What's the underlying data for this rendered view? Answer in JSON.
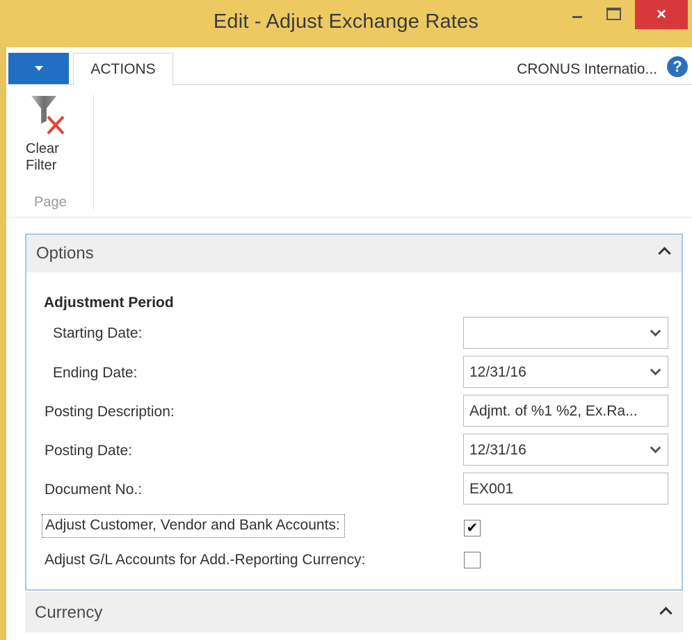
{
  "window": {
    "title": "Edit - Adjust Exchange Rates",
    "close_glyph": "×",
    "accent_color": "#edc962",
    "close_color": "#d9383a"
  },
  "ribbon": {
    "tab_actions": "ACTIONS",
    "company": "CRONUS Internatio...",
    "help_glyph": "?",
    "clear_filter_line1": "Clear",
    "clear_filter_line2": "Filter",
    "group_page": "Page"
  },
  "options": {
    "title": "Options",
    "group_caption": "Adjustment Period",
    "fields": {
      "starting_date": {
        "label": "Starting Date:",
        "value": ""
      },
      "ending_date": {
        "label": "Ending Date:",
        "value": "12/31/16"
      },
      "posting_description": {
        "label": "Posting Description:",
        "value": "Adjmt. of %1 %2, Ex.Ra..."
      },
      "posting_date": {
        "label": "Posting Date:",
        "value": "12/31/16"
      },
      "document_no": {
        "label": "Document No.:",
        "value": "EX001"
      },
      "adjust_cust_vend_bank": {
        "label": "Adjust Customer, Vendor and Bank Accounts:",
        "checked": true,
        "check_glyph": "✔"
      },
      "adjust_gl_acr": {
        "label": "Adjust G/L Accounts for Add.-Reporting Currency:",
        "checked": false,
        "check_glyph": ""
      }
    }
  },
  "currency": {
    "title": "Currency"
  },
  "icons": [
    "dropdown-arrow-icon",
    "help-icon",
    "clear-filter-icon",
    "minimize-icon",
    "maximize-icon",
    "close-icon",
    "chevron-up-icon",
    "chevron-down-icon",
    "checkmark-icon"
  ]
}
